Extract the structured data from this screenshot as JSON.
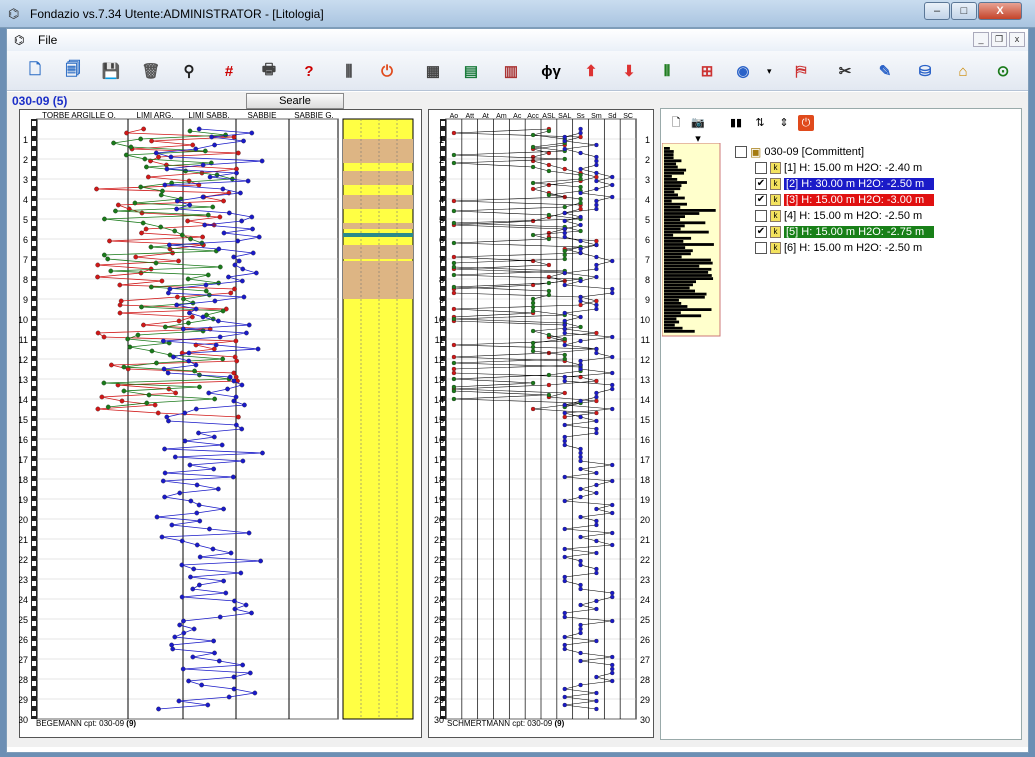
{
  "window": {
    "title": "Fondazio vs.7.34  Utente:ADMINISTRATOR - [Litologia]",
    "controls": [
      "–",
      "□",
      "X"
    ],
    "mdi_controls": [
      "_",
      "❐",
      "x"
    ]
  },
  "menu": {
    "file_label": "File"
  },
  "toolbar": {
    "buttons": [
      {
        "name": "new-doc-icon",
        "glyph": "🗋",
        "color": "#2b6cc4"
      },
      {
        "name": "copy-doc-icon",
        "glyph": "🗐",
        "color": "#2b6cc4"
      },
      {
        "name": "save-icon",
        "glyph": "💾",
        "color": "#1a2a55"
      },
      {
        "name": "trash-icon",
        "glyph": "🗑",
        "color": "#555"
      },
      {
        "name": "binoculars-icon",
        "glyph": "⚲",
        "color": "#222"
      },
      {
        "name": "grid-numbers-icon",
        "glyph": "#",
        "color": "#c00"
      },
      {
        "name": "print-icon",
        "glyph": "🖶",
        "color": "#444"
      },
      {
        "name": "help-icon",
        "glyph": "?",
        "color": "#c00"
      },
      {
        "name": "probe-tools-icon",
        "glyph": "⫼",
        "color": "#333"
      },
      {
        "name": "power-icon",
        "glyph": "⏻",
        "color": "#e04a1c"
      },
      {
        "name": "calculator-icon",
        "glyph": "▦",
        "color": "#444"
      },
      {
        "name": "layers-dialog-icon",
        "glyph": "▤",
        "color": "#1b7c3c"
      },
      {
        "name": "stratigraphy-icon",
        "glyph": "▥",
        "color": "#a33"
      },
      {
        "name": "phi-gamma-icon",
        "glyph": "ϕγ",
        "color": "#000"
      },
      {
        "name": "foundation-load-icon",
        "glyph": "⬆",
        "color": "#d33"
      },
      {
        "name": "foundation-settlement-icon",
        "glyph": "⬇",
        "color": "#d33"
      },
      {
        "name": "piles-icon",
        "glyph": "⫴",
        "color": "#1a7a1a"
      },
      {
        "name": "plan-grid-icon",
        "glyph": "⊞",
        "color": "#c33"
      },
      {
        "name": "google-earth-icon",
        "glyph": "◉",
        "color": "#2a62c8"
      },
      {
        "name": "map-icon",
        "glyph": "⛿",
        "color": "#c33"
      },
      {
        "name": "settings-tools-icon",
        "glyph": "✂",
        "color": "#333"
      },
      {
        "name": "sheet-edit-icon",
        "glyph": "✎",
        "color": "#2a62c8"
      },
      {
        "name": "database-icon",
        "glyph": "⛁",
        "color": "#2a62c8"
      },
      {
        "name": "building-icon",
        "glyph": "⌂",
        "color": "#c80"
      },
      {
        "name": "network-icon",
        "glyph": "⊙",
        "color": "#1a7a1a"
      }
    ]
  },
  "probe": {
    "id_label": "030-09  (5)",
    "searle_label": "Searle"
  },
  "left_chart": {
    "columns": [
      "TORBE ARGILLE O.",
      "LIMI ARG.",
      "LIMI SABB.",
      "SABBIE",
      "SABBIE G."
    ],
    "depth_ticks": [
      "1",
      "2",
      "3",
      "4",
      "5",
      "6",
      "7",
      "8",
      "9",
      "10",
      "11",
      "12",
      "13",
      "14",
      "15",
      "16",
      "17",
      "18",
      "19",
      "20",
      "21",
      "22",
      "23",
      "24",
      "25",
      "26",
      "27",
      "28",
      "29",
      "30"
    ],
    "footer": "BEGEMANN cpt: 030-09",
    "footer_count": "(9)"
  },
  "right_chart": {
    "columns": [
      "Ao",
      "Att",
      "At",
      "Am",
      "Ac",
      "Acc",
      "ASL",
      "SAL",
      "Ss",
      "Sm",
      "Sd",
      "SC"
    ],
    "depth_ticks": [
      "1",
      "2",
      "3",
      "4",
      "5",
      "6",
      "7",
      "8",
      "9",
      "10",
      "11",
      "12",
      "13",
      "14",
      "15",
      "16",
      "17",
      "18",
      "19",
      "20",
      "21",
      "22",
      "23",
      "24",
      "25",
      "26",
      "27",
      "28",
      "29",
      "30"
    ],
    "footer": "SCHMERTMANN cpt: 030-09",
    "footer_count": "(9)"
  },
  "colors": {
    "blue": "#1a1ac8",
    "red": "#d01818",
    "green": "#1a7a1a",
    "sand": "#ffff44",
    "clay": "#ddb584"
  },
  "right_panel": {
    "toolbar": [
      "🗋",
      "📷▾",
      "▮▮",
      "⇅",
      "⇕",
      "⏻"
    ],
    "tree": {
      "root": "030-09  [Committent]",
      "items": [
        {
          "label": "[1]  H: 15.00 m    H2O: -2.40 m",
          "checked": false,
          "highlight": ""
        },
        {
          "label": "[2]  H: 30.00 m    H2O: -2.50 m",
          "checked": true,
          "highlight": "#1a1ac8"
        },
        {
          "label": "[3]  H: 15.00 m    H2O: -3.00 m",
          "checked": true,
          "highlight": "#e01010"
        },
        {
          "label": "[4]  H: 15.00 m    H2O: -2.50 m",
          "checked": false,
          "highlight": ""
        },
        {
          "label": "[5]  H: 15.00 m    H2O: -2.75 m",
          "checked": true,
          "highlight": "#188018"
        },
        {
          "label": "[6]  H: 15.00 m    H2O: -2.50 m",
          "checked": false,
          "highlight": ""
        }
      ]
    }
  }
}
